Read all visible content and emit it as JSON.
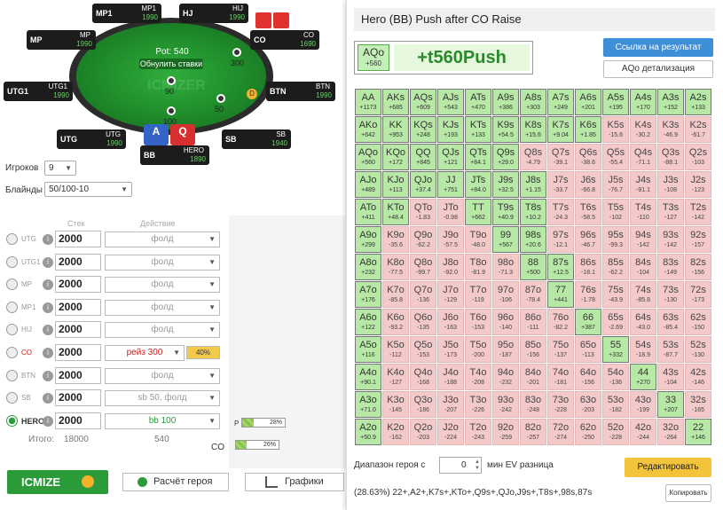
{
  "table": {
    "pot_label": "Pot: 540",
    "reset_bets": "Обнулить ставки",
    "watermark": "ICMIZER",
    "hero_cards": [
      "A",
      "Q"
    ],
    "dealer": "D",
    "chips": {
      "mp1": "",
      "co": "300",
      "sb": "50",
      "bb": "90",
      "bb2": "100"
    },
    "seats": [
      {
        "pos": "MP1",
        "name": "MP1",
        "stack": "1990",
        "bb": "20"
      },
      {
        "pos": "HJ",
        "name": "HIJ",
        "stack": "1990",
        "bb": "20"
      },
      {
        "pos": "MP",
        "name": "MP",
        "stack": "1990",
        "bb": "20"
      },
      {
        "pos": "CO",
        "name": "CO",
        "stack": "1690",
        "bb": "20"
      },
      {
        "pos": "UTG1",
        "name": "UTG1",
        "stack": "1990",
        "bb": "20"
      },
      {
        "pos": "BTN",
        "name": "BTN",
        "stack": "1990",
        "bb": "20"
      },
      {
        "pos": "UTG",
        "name": "UTG",
        "stack": "1990",
        "bb": "20"
      },
      {
        "pos": "SB",
        "name": "SB",
        "stack": "1940",
        "bb": "20"
      },
      {
        "pos": "BB",
        "name": "HERO",
        "stack": "1890",
        "bb": "20"
      }
    ]
  },
  "settings": {
    "players_label": "Игроков",
    "players_value": "9",
    "blinds_label": "Блайнды",
    "blinds_value": "50/100-10"
  },
  "columns": {
    "stack": "Стек",
    "action": "Действие"
  },
  "players": [
    {
      "pos": "UTG",
      "stack": "2000",
      "action": "фолд",
      "type": "normal"
    },
    {
      "pos": "UTG1",
      "stack": "2000",
      "action": "фолд",
      "type": "normal"
    },
    {
      "pos": "MP",
      "stack": "2000",
      "action": "фолд",
      "type": "normal"
    },
    {
      "pos": "MP1",
      "stack": "2000",
      "action": "фолд",
      "type": "normal"
    },
    {
      "pos": "HIJ",
      "stack": "2000",
      "action": "фолд",
      "type": "normal"
    },
    {
      "pos": "CO",
      "stack": "2000",
      "action": "рейз 300",
      "type": "co",
      "pct": "40%"
    },
    {
      "pos": "BTN",
      "stack": "2000",
      "action": "фолд",
      "type": "normal"
    },
    {
      "pos": "SB",
      "stack": "2000",
      "action": "sb 50, фолд",
      "type": "normal"
    },
    {
      "pos": "HERO",
      "stack": "2000",
      "action": "bb 100",
      "type": "hero"
    }
  ],
  "totals": {
    "label": "Итого:",
    "stack": "18000",
    "action": "540"
  },
  "bars": [
    {
      "prefix": "P",
      "pct": "28%",
      "fill": 0.28
    },
    {
      "prefix": "",
      "pct": "26%",
      "fill": 0.26
    }
  ],
  "co_label": "CO",
  "buttons": {
    "icmize": "ICMIZE",
    "hero_calc": "Расчёт героя",
    "charts": "Графики"
  },
  "panel": {
    "title": "Hero (BB) Push after CO Raise",
    "result_hand": "AQo",
    "result_hand_ev": "+560",
    "result_main": "+t560Push",
    "link_button": "Ссылка на результат",
    "detail_button": "AQo детализация",
    "range_label": "Диапазон героя с",
    "range_value": "0",
    "ev_label": "мин EV разница",
    "edit_button": "Редактировать",
    "range_text": "(28.63%) 22+,A2+,K7s+,KTo+,Q9s+,QJo,J9s+,T8s+,98s,87s",
    "copy_button": "Копировать"
  },
  "grid": [
    [
      [
        "AA",
        "+1173",
        1
      ],
      [
        "AKs",
        "+685",
        1
      ],
      [
        "AQs",
        "+609",
        1
      ],
      [
        "AJs",
        "+543",
        1
      ],
      [
        "ATs",
        "+470",
        1
      ],
      [
        "A9s",
        "+386",
        1
      ],
      [
        "A8s",
        "+303",
        1
      ],
      [
        "A7s",
        "+249",
        1
      ],
      [
        "A6s",
        "+201",
        1
      ],
      [
        "A5s",
        "+195",
        1
      ],
      [
        "A4s",
        "+170",
        1
      ],
      [
        "A3s",
        "+152",
        1
      ],
      [
        "A2s",
        "+133",
        1
      ]
    ],
    [
      [
        "AKo",
        "+642",
        1
      ],
      [
        "KK",
        "+953",
        1
      ],
      [
        "KQs",
        "+248",
        1
      ],
      [
        "KJs",
        "+193",
        1
      ],
      [
        "KTs",
        "+133",
        1
      ],
      [
        "K9s",
        "+54.5",
        1
      ],
      [
        "K8s",
        "+15.6",
        1
      ],
      [
        "K7s",
        "+9.04",
        1
      ],
      [
        "K6s",
        "+1.85",
        1
      ],
      [
        "K5s",
        "-15.6",
        0
      ],
      [
        "K4s",
        "-30.2",
        0
      ],
      [
        "K3s",
        "-46.9",
        0
      ],
      [
        "K2s",
        "-61.7",
        0
      ]
    ],
    [
      [
        "AQo",
        "+560",
        1
      ],
      [
        "KQo",
        "+172",
        1
      ],
      [
        "QQ",
        "+845",
        1
      ],
      [
        "QJs",
        "+121",
        1
      ],
      [
        "QTs",
        "+84.1",
        1
      ],
      [
        "Q9s",
        "+29.0",
        1
      ],
      [
        "Q8s",
        "-4.79",
        0
      ],
      [
        "Q7s",
        "-39.1",
        0
      ],
      [
        "Q6s",
        "-38.6",
        0
      ],
      [
        "Q5s",
        "-55.4",
        0
      ],
      [
        "Q4s",
        "-71.1",
        0
      ],
      [
        "Q3s",
        "-88.1",
        0
      ],
      [
        "Q2s",
        "-103",
        0
      ]
    ],
    [
      [
        "AJo",
        "+489",
        1
      ],
      [
        "KJo",
        "+113",
        1
      ],
      [
        "QJo",
        "+37.4",
        1
      ],
      [
        "JJ",
        "+751",
        1
      ],
      [
        "JTs",
        "+84.0",
        1
      ],
      [
        "J9s",
        "+32.5",
        1
      ],
      [
        "J8s",
        "+1.15",
        1
      ],
      [
        "J7s",
        "-33.7",
        0
      ],
      [
        "J6s",
        "-66.8",
        0
      ],
      [
        "J5s",
        "-76.7",
        0
      ],
      [
        "J4s",
        "-91.1",
        0
      ],
      [
        "J3s",
        "-108",
        0
      ],
      [
        "J2s",
        "-123",
        0
      ]
    ],
    [
      [
        "ATo",
        "+411",
        1
      ],
      [
        "KTo",
        "+48.4",
        1
      ],
      [
        "QTo",
        "-1.83",
        0
      ],
      [
        "JTo",
        "-0.98",
        0
      ],
      [
        "TT",
        "+662",
        1
      ],
      [
        "T9s",
        "+40.9",
        1
      ],
      [
        "T8s",
        "+10.2",
        1
      ],
      [
        "T7s",
        "-24.3",
        0
      ],
      [
        "T6s",
        "-58.5",
        0
      ],
      [
        "T5s",
        "-102",
        0
      ],
      [
        "T4s",
        "-110",
        0
      ],
      [
        "T3s",
        "-127",
        0
      ],
      [
        "T2s",
        "-142",
        0
      ]
    ],
    [
      [
        "A9o",
        "+299",
        1
      ],
      [
        "K9o",
        "-35.6",
        0
      ],
      [
        "Q9o",
        "-62.2",
        0
      ],
      [
        "J9o",
        "-57.5",
        0
      ],
      [
        "T9o",
        "-48.0",
        0
      ],
      [
        "99",
        "+567",
        1
      ],
      [
        "98s",
        "+20.6",
        1
      ],
      [
        "97s",
        "-12.1",
        0
      ],
      [
        "96s",
        "-46.7",
        0
      ],
      [
        "95s",
        "-99.3",
        0
      ],
      [
        "94s",
        "-142",
        0
      ],
      [
        "93s",
        "-142",
        0
      ],
      [
        "92s",
        "-157",
        0
      ]
    ],
    [
      [
        "A8o",
        "+232",
        1
      ],
      [
        "K8o",
        "-77.5",
        0
      ],
      [
        "Q8o",
        "-99.7",
        0
      ],
      [
        "J8o",
        "-92.0",
        0
      ],
      [
        "T8o",
        "-81.9",
        0
      ],
      [
        "98o",
        "-71.3",
        0
      ],
      [
        "88",
        "+500",
        1
      ],
      [
        "87s",
        "+12.5",
        1
      ],
      [
        "86s",
        "-18.1",
        0
      ],
      [
        "85s",
        "-62.2",
        0
      ],
      [
        "84s",
        "-104",
        0
      ],
      [
        "83s",
        "-149",
        0
      ],
      [
        "82s",
        "-156",
        0
      ]
    ],
    [
      [
        "A7o",
        "+176",
        1
      ],
      [
        "K7o",
        "-85.8",
        0
      ],
      [
        "Q7o",
        "-136",
        0
      ],
      [
        "J7o",
        "-129",
        0
      ],
      [
        "T7o",
        "-119",
        0
      ],
      [
        "97o",
        "-106",
        0
      ],
      [
        "87o",
        "-78.4",
        0
      ],
      [
        "77",
        "+441",
        1
      ],
      [
        "76s",
        "-1.78",
        0
      ],
      [
        "75s",
        "-43.9",
        0
      ],
      [
        "74s",
        "-85.8",
        0
      ],
      [
        "73s",
        "-130",
        0
      ],
      [
        "72s",
        "-173",
        0
      ]
    ],
    [
      [
        "A6o",
        "+122",
        1
      ],
      [
        "K6o",
        "-93.2",
        0
      ],
      [
        "Q6o",
        "-135",
        0
      ],
      [
        "J6o",
        "-163",
        0
      ],
      [
        "T6o",
        "-153",
        0
      ],
      [
        "96o",
        "-140",
        0
      ],
      [
        "86o",
        "-111",
        0
      ],
      [
        "76o",
        "-82.2",
        0
      ],
      [
        "66",
        "+387",
        1
      ],
      [
        "65s",
        "-2.69",
        0
      ],
      [
        "64s",
        "-43.0",
        0
      ],
      [
        "63s",
        "-85.4",
        0
      ],
      [
        "62s",
        "-150",
        0
      ]
    ],
    [
      [
        "A5o",
        "+116",
        1
      ],
      [
        "K5o",
        "-112",
        0
      ],
      [
        "Q5o",
        "-153",
        0
      ],
      [
        "J5o",
        "-173",
        0
      ],
      [
        "T5o",
        "-200",
        0
      ],
      [
        "95o",
        "-187",
        0
      ],
      [
        "85o",
        "-156",
        0
      ],
      [
        "75o",
        "-137",
        0
      ],
      [
        "65o",
        "-113",
        0
      ],
      [
        "55",
        "+332",
        1
      ],
      [
        "54s",
        "-18.9",
        0
      ],
      [
        "53s",
        "-87.7",
        0
      ],
      [
        "52s",
        "-130",
        0
      ]
    ],
    [
      [
        "A4o",
        "+90.1",
        1
      ],
      [
        "K4o",
        "-127",
        0
      ],
      [
        "Q4o",
        "-168",
        0
      ],
      [
        "J4o",
        "-188",
        0
      ],
      [
        "T4o",
        "-208",
        0
      ],
      [
        "94o",
        "-232",
        0
      ],
      [
        "84o",
        "-201",
        0
      ],
      [
        "74o",
        "-181",
        0
      ],
      [
        "64o",
        "-156",
        0
      ],
      [
        "54o",
        "-136",
        0
      ],
      [
        "44",
        "+270",
        1
      ],
      [
        "43s",
        "-104",
        0
      ],
      [
        "42s",
        "-146",
        0
      ]
    ],
    [
      [
        "A3o",
        "+71.0",
        1
      ],
      [
        "K3o",
        "-145",
        0
      ],
      [
        "Q3o",
        "-186",
        0
      ],
      [
        "J3o",
        "-207",
        0
      ],
      [
        "T3o",
        "-226",
        0
      ],
      [
        "93o",
        "-242",
        0
      ],
      [
        "83o",
        "-248",
        0
      ],
      [
        "73o",
        "-228",
        0
      ],
      [
        "63o",
        "-203",
        0
      ],
      [
        "53o",
        "-182",
        0
      ],
      [
        "43o",
        "-199",
        0
      ],
      [
        "33",
        "+207",
        1
      ],
      [
        "32s",
        "-165",
        0
      ]
    ],
    [
      [
        "A2o",
        "+50.9",
        1
      ],
      [
        "K2o",
        "-162",
        0
      ],
      [
        "Q2o",
        "-203",
        0
      ],
      [
        "J2o",
        "-224",
        0
      ],
      [
        "T2o",
        "-243",
        0
      ],
      [
        "92o",
        "-259",
        0
      ],
      [
        "82o",
        "-257",
        0
      ],
      [
        "72o",
        "-274",
        0
      ],
      [
        "62o",
        "-250",
        0
      ],
      [
        "52o",
        "-228",
        0
      ],
      [
        "42o",
        "-244",
        0
      ],
      [
        "32o",
        "-264",
        0
      ],
      [
        "22",
        "+146",
        1
      ]
    ]
  ]
}
